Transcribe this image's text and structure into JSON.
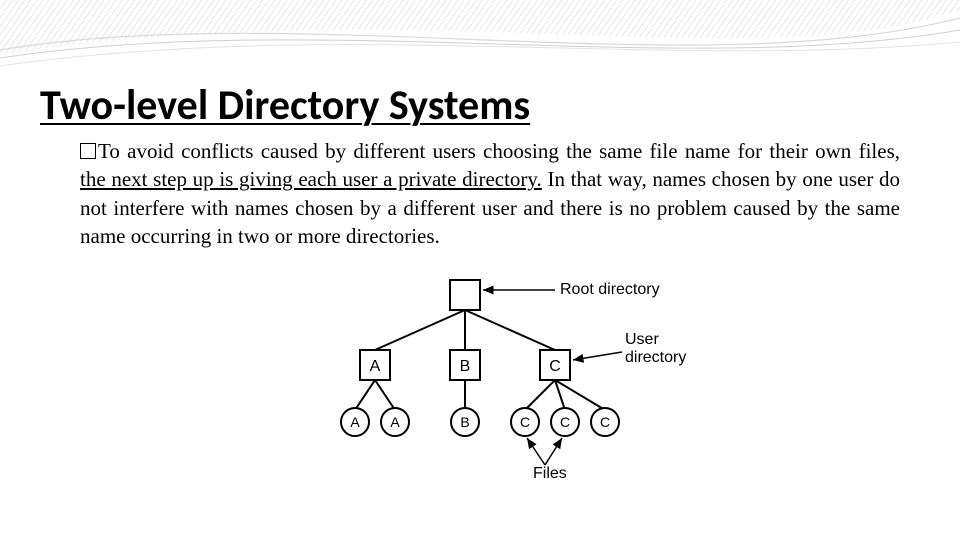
{
  "slide": {
    "title": "Two-level Directory Systems",
    "para_prefix": "To avoid conflicts caused by different users choosing the same file name for their own files, ",
    "para_emph": "the next step up is giving each user a private directory.",
    "para_suffix": " In that way, names chosen by one user do not interfere with names chosen by a different user and there is no problem caused by the same name occurring in two or more directories."
  },
  "diagram": {
    "label_root": "Root directory",
    "label_userdir": "User directory",
    "label_files": "Files",
    "dir_labels": [
      "A",
      "B",
      "C"
    ],
    "file_labels": [
      "A",
      "A",
      "B",
      "C",
      "C",
      "C"
    ]
  }
}
